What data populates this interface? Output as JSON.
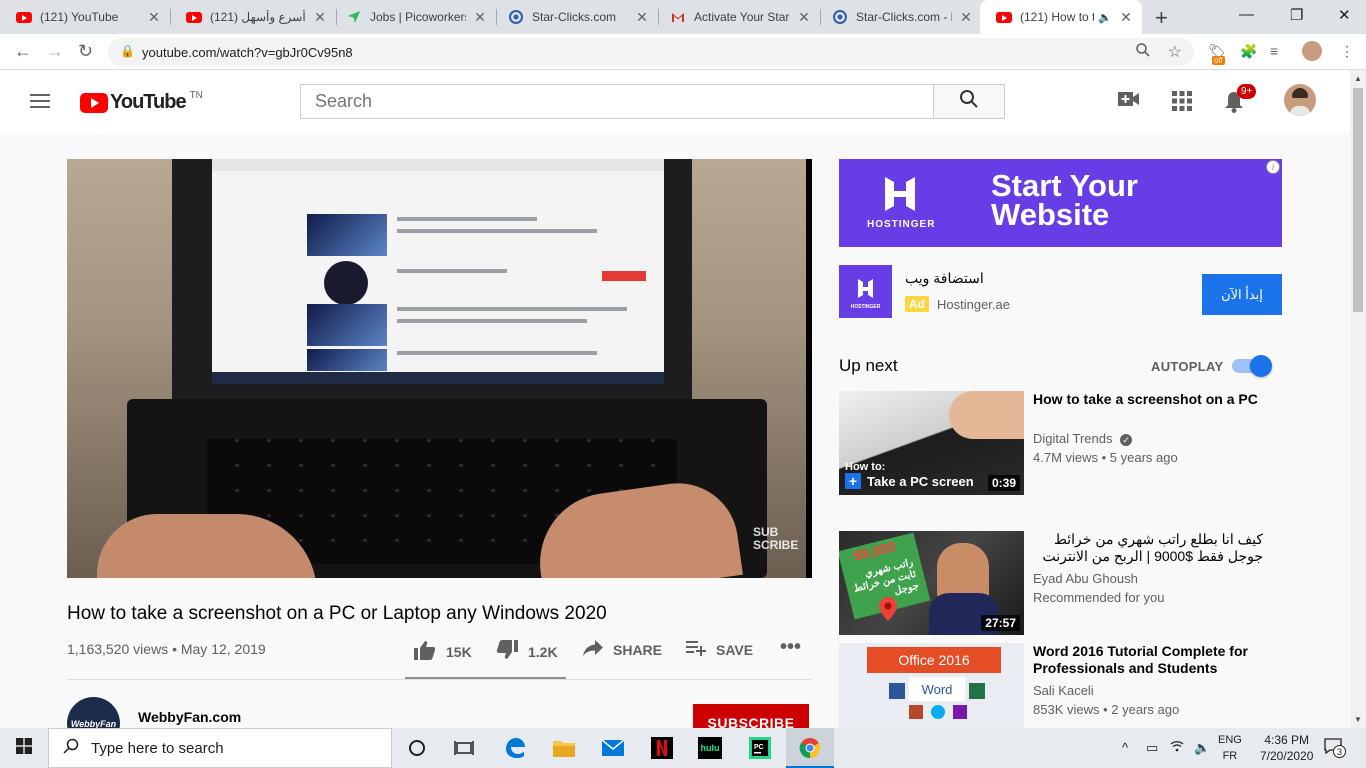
{
  "browser": {
    "tabs": [
      {
        "title": "(121) YouTube",
        "icon": "youtube-icon",
        "active": false
      },
      {
        "title": "(121) أسرع وأسهل",
        "icon": "youtube-icon",
        "active": false
      },
      {
        "title": "Jobs | Picoworkers",
        "icon": "picoworkers-icon",
        "active": false
      },
      {
        "title": "Star-Clicks.com",
        "icon": "starclicks-icon",
        "active": false
      },
      {
        "title": "Activate Your Star-",
        "icon": "gmail-icon",
        "active": false
      },
      {
        "title": "Star-Clicks.com - N",
        "icon": "starclicks-icon",
        "active": false
      },
      {
        "title": "(121) How to t",
        "icon": "youtube-icon",
        "active": true
      }
    ],
    "url": "youtube.com/watch?v=gbJr0Cv95n8",
    "extension_badge": "off"
  },
  "youtube": {
    "logo_text": "YouTube",
    "country_code": "TN",
    "search_placeholder": "Search",
    "notification_count": "9+",
    "brand_red": "#ff0000"
  },
  "video": {
    "title": "How to take a screenshot on a PC or Laptop any Windows 2020",
    "stats": "1,163,520 views • May 12, 2019",
    "likes": "15K",
    "dislikes": "1.2K",
    "share_label": "SHARE",
    "save_label": "SAVE",
    "overlay_text_1": "SUB",
    "overlay_text_2": "SCRIBE",
    "channel_name": "WebbyFan.com",
    "channel_avatar_text": "WebbyFan",
    "subscribe_label": "SUBSCRIBE"
  },
  "ad": {
    "brand": "HOSTINGER",
    "headline_1": "Start Your",
    "headline_2": "Website",
    "title": "استضافة ويب",
    "tag": "Ad",
    "domain": "Hostinger.ae",
    "cta": "إبدأ الآن",
    "info": "i",
    "brand_color": "#673de6"
  },
  "up_next": {
    "heading": "Up next",
    "autoplay_label": "AUTOPLAY",
    "autoplay_on": true
  },
  "recommendations": [
    {
      "title": "How to take a screenshot on a PC",
      "channel": "Digital Trends",
      "verified": true,
      "meta": "4.7M views • 5 years ago",
      "duration": "0:39",
      "thumb_caption_1": "How to:",
      "thumb_caption_2": "Take a PC screen"
    },
    {
      "title": "كيف انا بطلع راتب شهري من خرائط جوجل فقط $9000 | الربح من الانترنت",
      "channel": "Eyad Abu Ghoush",
      "verified": false,
      "meta": "Recommended for you",
      "duration": "27:57",
      "thumb_caption_1": "$9,000",
      "thumb_caption_2": "راتب شهري ثابت من خرائط جوجل"
    },
    {
      "title": "Word 2016 Tutorial Complete for Professionals and Students",
      "channel": "Sali Kaceli",
      "verified": false,
      "meta": "853K views • 2 years ago",
      "duration": "",
      "thumb_caption_1": "Office 2016",
      "thumb_caption_2": "Word"
    }
  ],
  "taskbar": {
    "search_placeholder": "Type here to search",
    "lang_1": "ENG",
    "lang_2": "FR",
    "time": "4:36 PM",
    "date": "7/20/2020",
    "notification_count": "3",
    "apps": [
      "task-view-icon",
      "edge-icon",
      "file-explorer-icon",
      "mail-icon",
      "netflix-icon",
      "hulu-icon",
      "pycharm-icon",
      "chrome-icon"
    ]
  }
}
